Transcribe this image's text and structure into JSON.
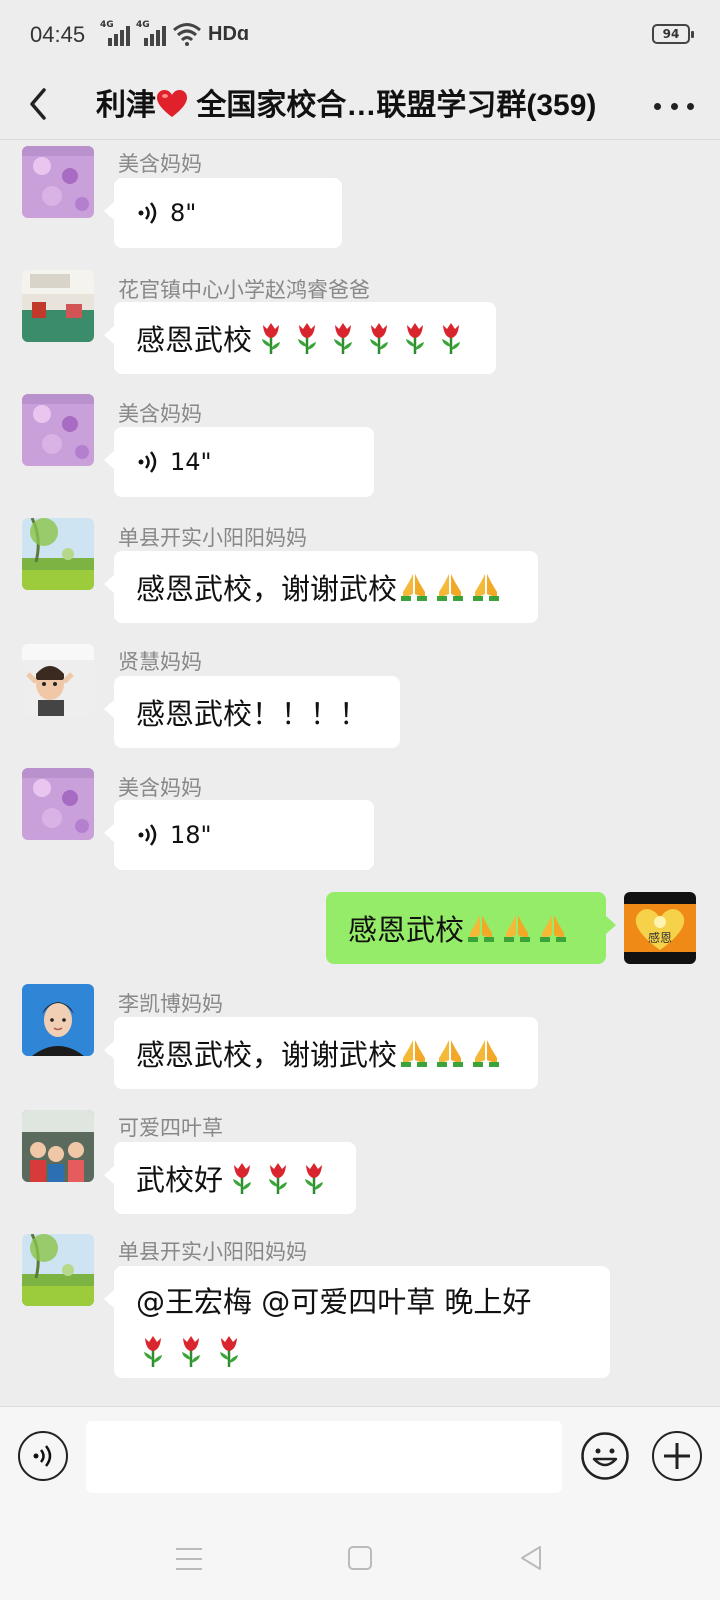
{
  "status_bar": {
    "time": "04:45",
    "network_1": "4G",
    "network_2": "4G",
    "hd_label": "HDɑ",
    "battery": "94"
  },
  "header": {
    "title_prefix": "利津",
    "title_suffix": " 全国家校合…联盟学习群(359)",
    "title_icon": "red-heart-emoji"
  },
  "messages": [
    {
      "sender": "美含妈妈",
      "type": "voice",
      "duration": "8\""
    },
    {
      "sender": "花官镇中心小学赵鸿睿爸爸",
      "type": "text",
      "text": "感恩武校",
      "emoji": "tulip",
      "emoji_count": 6
    },
    {
      "sender": "美含妈妈",
      "type": "voice",
      "duration": "14\""
    },
    {
      "sender": "单县开实小阳阳妈妈",
      "type": "text",
      "text": "感恩武校，谢谢武校",
      "emoji": "folded-hands",
      "emoji_count": 3
    },
    {
      "sender": "贤慧妈妈",
      "type": "text",
      "text": "感恩武校！！！！"
    },
    {
      "sender": "美含妈妈",
      "type": "voice",
      "duration": "18\""
    },
    {
      "sender": "",
      "type": "text",
      "own": true,
      "text": "感恩武校",
      "emoji": "folded-hands",
      "emoji_count": 3,
      "avatar_text": "感恩"
    },
    {
      "sender": "李凯博妈妈",
      "type": "text",
      "text": "感恩武校，谢谢武校",
      "emoji": "folded-hands",
      "emoji_count": 3
    },
    {
      "sender": "可爱四叶草",
      "type": "text",
      "text": "武校好",
      "emoji": "tulip",
      "emoji_count": 3
    },
    {
      "sender": "单县开实小阳阳妈妈",
      "type": "text",
      "text": "@王宏梅 @可爱四叶草 晚上好",
      "emoji": "tulip",
      "emoji_count": 3
    }
  ],
  "colors": {
    "background": "#ededed",
    "own_bubble": "#95ec69",
    "other_bubble": "#ffffff",
    "sender_name": "#888888"
  }
}
